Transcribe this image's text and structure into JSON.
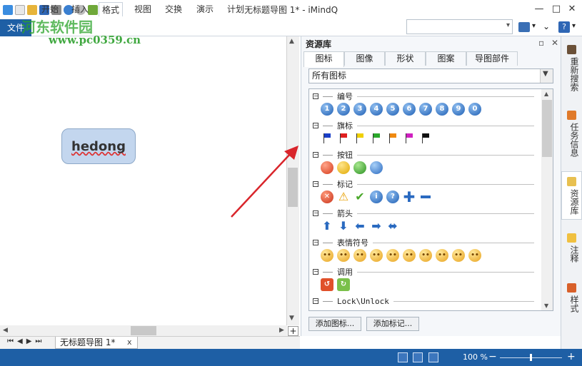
{
  "window": {
    "title": "无标题导图 1* - iMindQ",
    "minimize_label": "—",
    "maximize_label": "□",
    "close_label": "✕"
  },
  "watermark": {
    "line1": "河东软件园",
    "line2": "www.pc0359.cn"
  },
  "ribbon": {
    "tabs": [
      "文件",
      "开始",
      "插入",
      "格式",
      "视图",
      "交换",
      "演示",
      "计划"
    ],
    "search_value": "",
    "help_label": "?"
  },
  "canvas": {
    "node_text": "hedong"
  },
  "document_tab": {
    "label": "无标题导图 1*",
    "close_label": "x"
  },
  "panel": {
    "title": "资源库",
    "tabs": [
      "图标",
      "图像",
      "形状",
      "图案",
      "导图部件"
    ],
    "active_tab": "图标",
    "filter_selected": "所有图标",
    "groups": [
      {
        "label": "编号",
        "icons": [
          "1",
          "2",
          "3",
          "4",
          "5",
          "6",
          "7",
          "8",
          "9",
          "0"
        ]
      },
      {
        "label": "旗标",
        "icons": [
          "flag-blue",
          "flag-red",
          "flag-yellow",
          "flag-green",
          "flag-orange",
          "flag-magenta",
          "flag-black"
        ]
      },
      {
        "label": "按钮",
        "icons": [
          "button-red",
          "button-yellow",
          "button-green",
          "button-blue"
        ]
      },
      {
        "label": "标记",
        "icons": [
          "x-mark",
          "warning",
          "check",
          "info",
          "question",
          "plus",
          "minus"
        ]
      },
      {
        "label": "箭头",
        "icons": [
          "arrow-up",
          "arrow-down",
          "arrow-left",
          "arrow-right",
          "arrow-left-right"
        ]
      },
      {
        "label": "表情符号",
        "icons": [
          "smile-1",
          "smile-2",
          "smile-3",
          "smile-4",
          "smile-5",
          "smile-6",
          "smile-7",
          "smile-8",
          "smile-9",
          "smile-10"
        ]
      },
      {
        "label": "调用",
        "icons": [
          "call-red",
          "call-green"
        ]
      },
      {
        "label": "Lock\\Unlock",
        "icons": []
      }
    ],
    "add_icon_button": "添加图标...",
    "add_mark_button": "添加标记..."
  },
  "right_sidebar": {
    "items": [
      "重新搜索",
      "任务信息",
      "资源库",
      "注释",
      "样式"
    ]
  },
  "status": {
    "zoom": "100 %",
    "zoom_minus": "−",
    "zoom_plus": "+"
  },
  "colors": {
    "accent": "#1e5fa5",
    "node_fill": "#c3d6ee",
    "annotation_arrow": "#d9252b"
  }
}
